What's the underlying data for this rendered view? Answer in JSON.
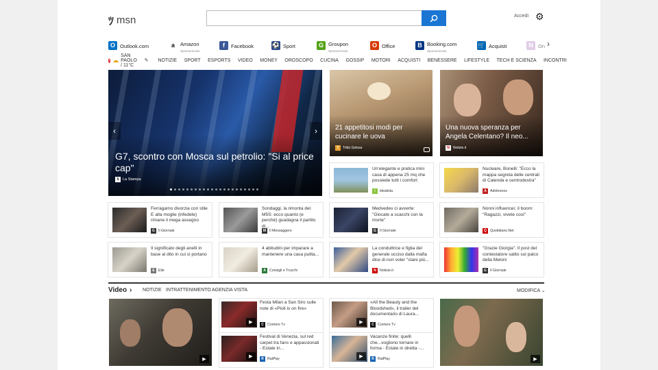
{
  "header": {
    "logo_text": "msn",
    "search_placeholder": "",
    "signin_label": "Accedi"
  },
  "quicklinks": [
    {
      "label": "Outlook.com",
      "sub": "",
      "icon": "outlook-icon",
      "color": "#0072c6",
      "glyph": "O"
    },
    {
      "label": "Amazon",
      "sub": "Sponsorizzato",
      "icon": "amazon-icon",
      "color": "#ffffff",
      "glyph": "a"
    },
    {
      "label": "Facebook",
      "sub": "",
      "icon": "facebook-icon",
      "color": "#3b5998",
      "glyph": "f"
    },
    {
      "label": "Sport",
      "sub": "",
      "icon": "sport-icon",
      "color": "#2b4a8a",
      "glyph": "⚽"
    },
    {
      "label": "Groupon",
      "sub": "Sponsorizzato",
      "icon": "groupon-icon",
      "color": "#53a318",
      "glyph": "G"
    },
    {
      "label": "Office",
      "sub": "",
      "icon": "office-icon",
      "color": "#d83b01",
      "glyph": "O"
    },
    {
      "label": "Booking.com",
      "sub": "Sponsorizzato",
      "icon": "booking-icon",
      "color": "#003580",
      "glyph": "B"
    },
    {
      "label": "Acquisti",
      "sub": "",
      "icon": "shopping-cart-icon",
      "color": "#0067b8",
      "glyph": "🛒"
    },
    {
      "label": "On",
      "sub": "",
      "icon": "onenote-icon",
      "color": "#c9a5d6",
      "glyph": "N"
    }
  ],
  "navbar": {
    "weather": "SAN PAOLO / 11°C",
    "items": [
      "NOTIZIE",
      "SPORT",
      "ESPORTS",
      "VIDEO",
      "MONEY",
      "OROSCOPO",
      "CUCINA",
      "GOSSIP",
      "MOTORI",
      "ACQUISTI",
      "BENESSERE",
      "LIFESTYLE",
      "TECH E SCIENZA",
      "INCONTRI"
    ]
  },
  "hero": {
    "title": "G7, scontro con Mosca sul petrolio: \"Si al price cap\"",
    "source": "La Stampa",
    "dot_count": 22,
    "active_dot": 0
  },
  "big_tiles": [
    {
      "title": "21 appetitosi modi per cucinare le uova",
      "source": "Tribù Golosa"
    },
    {
      "title": "Una nuova speranza per Angela Celentano? Il neo...",
      "source": "Notizie.it"
    }
  ],
  "cards": [
    {
      "title": "Un'elegante e pratica mini casa di appena 25 mq che possiede tutti i comfort",
      "source": "idealista"
    },
    {
      "title": "Nucleare, Bonelli: \"Ecco la mappa segreta delle centrali di Calenda e centrodestra\"",
      "source": "Adnkronos"
    },
    {
      "title": "Ferragamo divorzia con stile E alla moglie (infedele) rimane il mega assegno",
      "source": "Il Giornale"
    },
    {
      "title": "Sondaggi, la rimonta del M5S: ecco quanto (e perché) guadagna il partito di...",
      "source": "Il Messaggero"
    },
    {
      "title": "Medvedev ci avverte: \"Giocate a scacchi con la morte\"",
      "source": "Il Giornale"
    },
    {
      "title": "Nonni influencer, il boom: \"Ragazzi, vivete così\"",
      "source": "Quotidiano.Net"
    },
    {
      "title": "Il significato degli anelli in base al dito in cui si portano",
      "source": "Elle"
    },
    {
      "title": "4 abitudini per imparare a mantenere una casa pulita...",
      "source": "Consigli e Trucchi"
    },
    {
      "title": "La conduttrice e figlia del generale ucciso dalla mafia dice di non voler \"stare più...",
      "source": "Notizie.it"
    },
    {
      "title": "\"Grazie Giorgia\". Il post del contestatore salito sul palco della Meloni",
      "source": "Il Giornale"
    }
  ],
  "video": {
    "heading": "Video",
    "tabs": [
      "NOTIZIE",
      "INTRATTENIMENTO",
      "AGENZIA VISTA"
    ],
    "edit_label": "MODIFICA",
    "cards": [
      {
        "title": "Festa Milan a San Siro sulle note di «Pioli is on fire»",
        "source": "Corriere Tv"
      },
      {
        "title": "«All the Beauty and the Bloodshed», il trailer del documentario di Laura...",
        "source": "Corriere Tv"
      },
      {
        "title": "Festival di Venezia, sul red carpet tra fans e appassionati - Estate in...",
        "source": "RaiPlay"
      },
      {
        "title": "Vacanze finite: quelli che...vogliono tornare in forma - Estate in diretta -...",
        "source": "RaiPlay"
      }
    ]
  },
  "colors": {
    "accent": "#1a76d2",
    "page_bg": "#f0f0f0"
  }
}
